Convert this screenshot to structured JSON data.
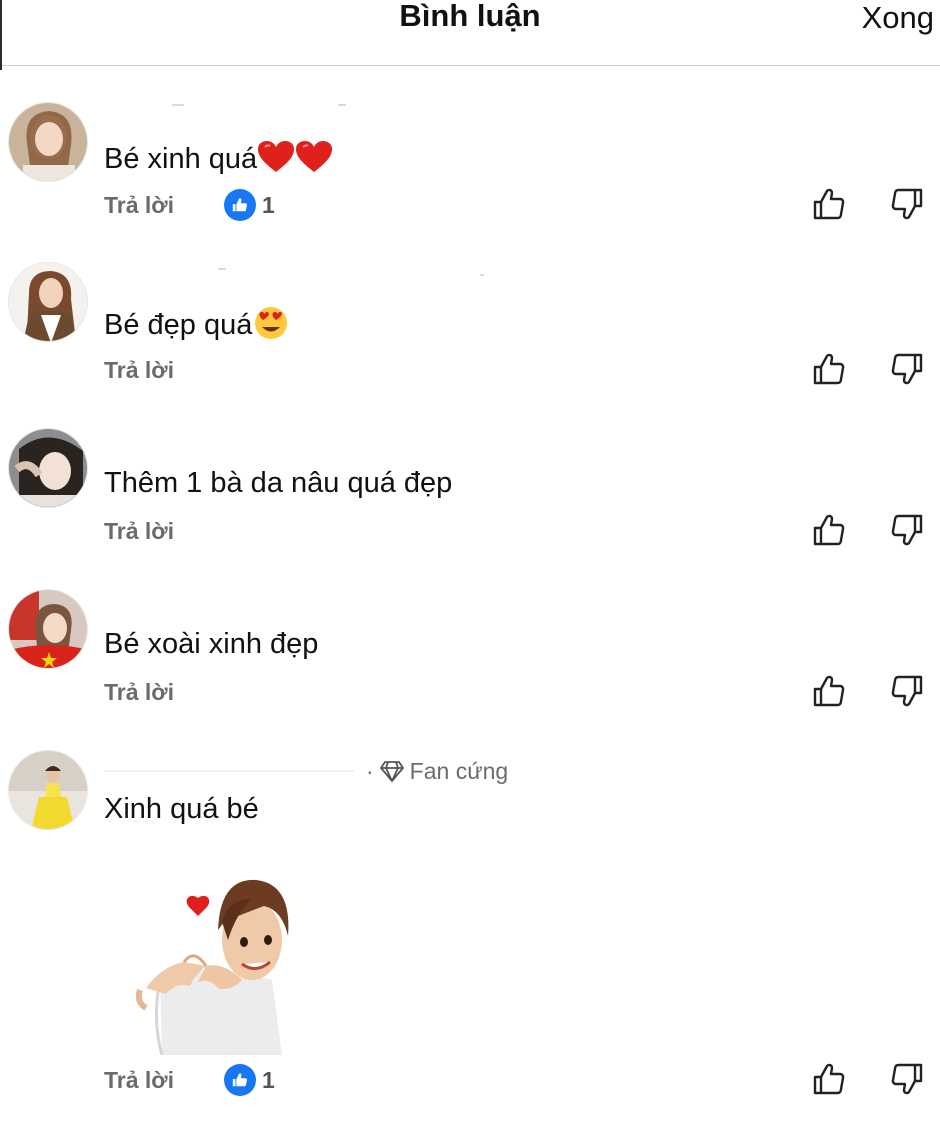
{
  "header": {
    "title": "Bình luận",
    "done_label": "Xong"
  },
  "reply_label": "Trả lời",
  "comments": [
    {
      "text": "Bé xinh quá",
      "emoji": "hearts",
      "like_count": "1"
    },
    {
      "text": "Bé đẹp quá",
      "emoji": "heart-eyes"
    },
    {
      "text": "Thêm 1 bà da nâu quá đẹp"
    },
    {
      "text": "Bé xoài xinh đẹp"
    },
    {
      "text": "Xinh quá bé",
      "badge": "Fan cứng",
      "sticker": "heart-hands-avatar-sticker",
      "like_count": "1"
    }
  ],
  "colors": {
    "like_blue": "#1877f2",
    "muted_text": "#6b6b6b",
    "divider": "#cfcfcf"
  },
  "icons": {
    "like": "thumbs-up-outline",
    "dislike": "thumbs-down-outline",
    "badge": "diamond-icon"
  }
}
